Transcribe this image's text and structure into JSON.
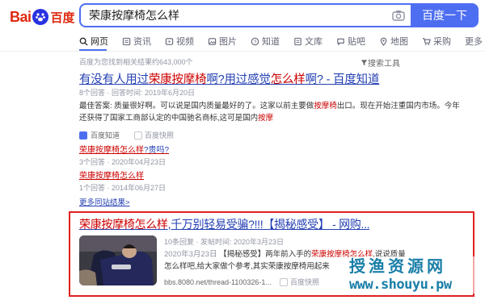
{
  "logo": {
    "bai": "Bai",
    "du": "du",
    "zh": "百度"
  },
  "search": {
    "query": "荣康按摩椅怎么样",
    "button_label": "百度一下",
    "camera_icon": "camera-icon"
  },
  "tabs": [
    {
      "label": "网页",
      "icon": "search-icon",
      "active": true
    },
    {
      "label": "资讯",
      "icon": "news-icon"
    },
    {
      "label": "视频",
      "icon": "video-icon"
    },
    {
      "label": "图片",
      "icon": "image-icon"
    },
    {
      "label": "知道",
      "icon": "question-icon"
    },
    {
      "label": "文库",
      "icon": "doc-icon"
    },
    {
      "label": "贴吧",
      "icon": "forum-icon"
    },
    {
      "label": "地图",
      "icon": "map-icon"
    },
    {
      "label": "采购",
      "icon": "cart-icon"
    },
    {
      "label": "更多"
    }
  ],
  "result_count": "百度为您找到相关结果约643,000个",
  "search_tools": "搜索工具",
  "result1": {
    "title_pre": "有没有人用过",
    "title_em": "荣康按摩椅",
    "title_mid": "啊?用过感觉",
    "title_em2": "怎么样",
    "title_post": "啊? - 百度知道",
    "meta": "8个回答 · 回答时间: 2019年6月20日",
    "abstract_a": "最佳答案: 质量很好啊。可以说是国内质量最好的了。这家以前主要做",
    "abstract_em": "按摩椅",
    "abstract_b": "出口。现在开始注重国内市场。今年还获得了国家工商部认定的中国驰名商标,这可是国内",
    "abstract_em2": "按摩",
    "source": "百度知道",
    "cache": "百度快照",
    "sub1_em": "荣康按摩椅怎么样",
    "sub1_plain": "?贵吗?",
    "sub1_meta": "3个回答 · 2020年04月23日",
    "sub2_em": "荣康按摩椅怎么样",
    "sub2_meta": "1个回答 · 2014年06月27日",
    "more": "更多同站结果>"
  },
  "result2": {
    "title_em": "荣康按摩椅怎么样",
    "title_post": ",千万别轻易受骗?!!!【揭秘感受】 - 网购...",
    "meta": "10条回复 · 发帖时间: 2020年3月23日",
    "date": "2020年3月23日",
    "abstract_a": "【揭秘感受】两年前入手的",
    "abstract_em": "荣康按摩椅怎么样",
    "abstract_b": ",说说质量怎么样吧,给大家做个参考,其实荣康按摩椅用起来",
    "url": "bbs.8080.net/thread-1100326-1...",
    "cache": "百度快照"
  },
  "watermark": {
    "cn": "授渔资源网",
    "url": "www.shouyu.pw"
  },
  "colors": {
    "accent": "#4e6ef2",
    "link": "#2440b3",
    "highlight": "#c00",
    "box": "#e02020"
  }
}
